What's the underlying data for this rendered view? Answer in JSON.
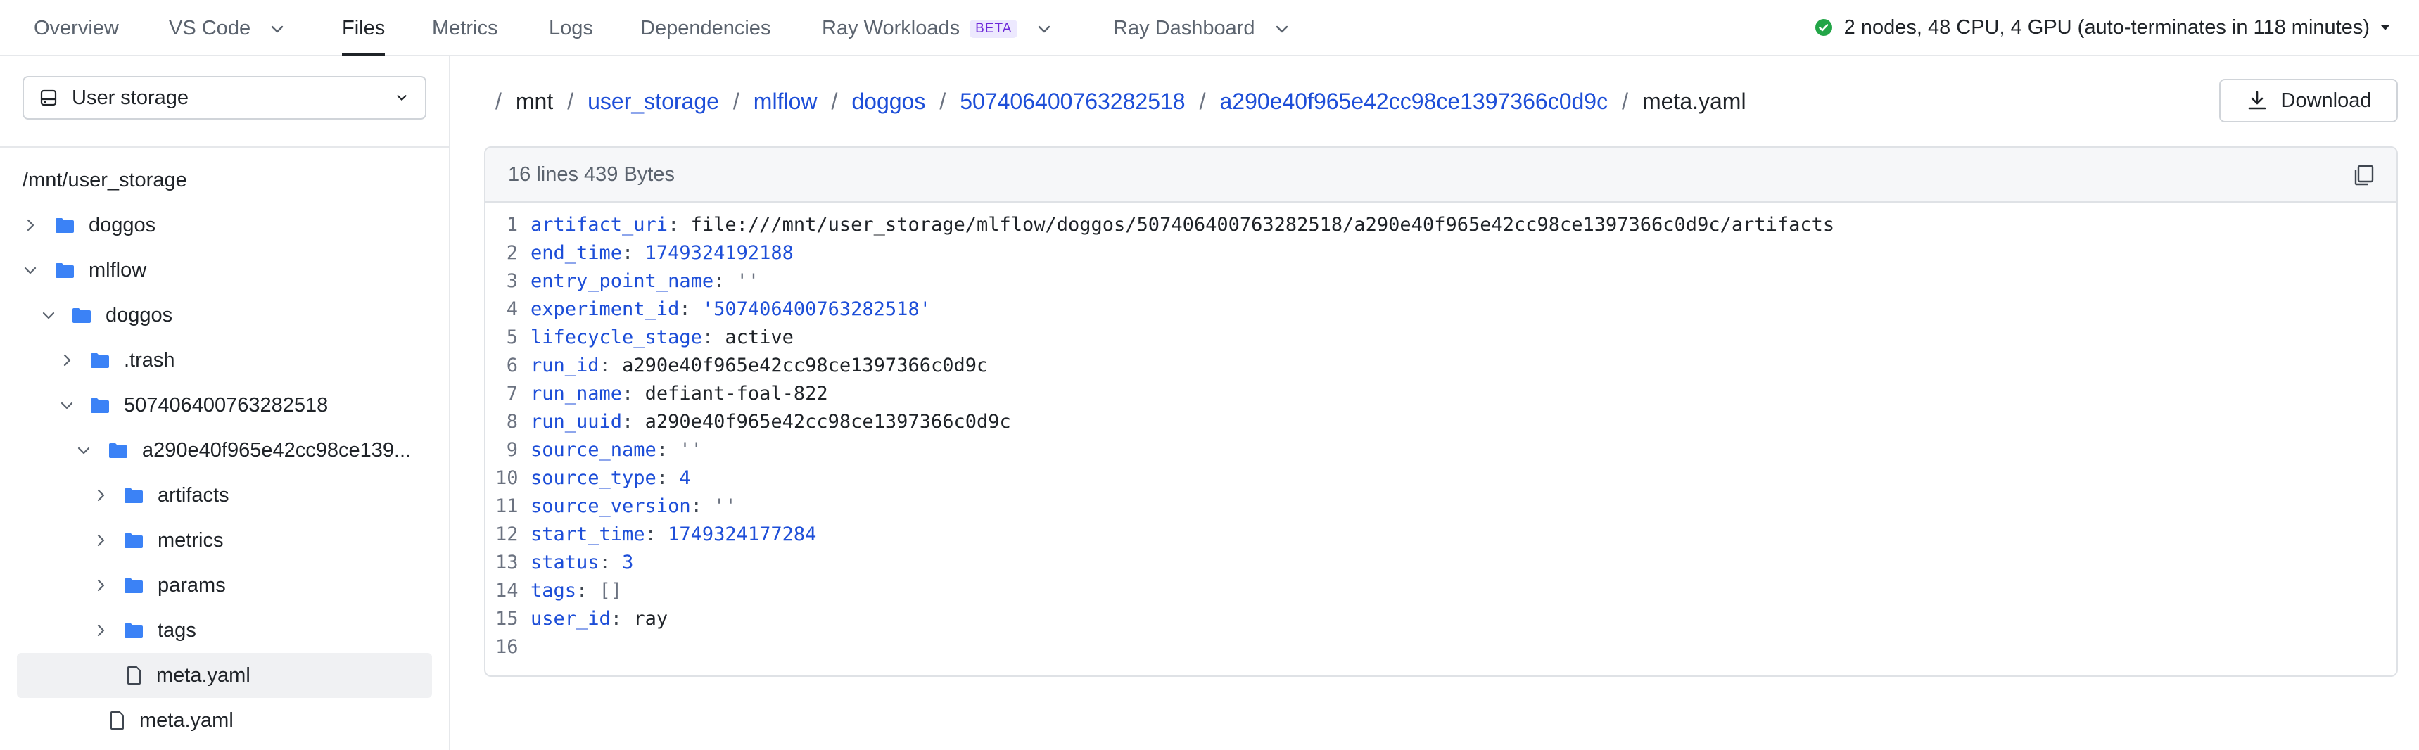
{
  "nav": {
    "items": [
      {
        "label": "Overview",
        "active": false
      },
      {
        "label": "VS Code",
        "active": false,
        "dropdown": true
      },
      {
        "label": "Files",
        "active": true
      },
      {
        "label": "Metrics",
        "active": false
      },
      {
        "label": "Logs",
        "active": false
      },
      {
        "label": "Dependencies",
        "active": false
      },
      {
        "label": "Ray Workloads",
        "active": false,
        "dropdown": true,
        "badge": "BETA"
      },
      {
        "label": "Ray Dashboard",
        "active": false,
        "dropdown": true
      }
    ],
    "cluster_status": "2 nodes, 48 CPU, 4 GPU  (auto-terminates in 118 minutes)",
    "status_color": "#22a547"
  },
  "sidebar": {
    "storage_select": "User storage",
    "root_path": "/mnt/user_storage",
    "tree": [
      {
        "label": "doggos",
        "type": "folder",
        "expanded": false
      },
      {
        "label": "mlflow",
        "type": "folder",
        "expanded": true
      },
      {
        "label": "doggos",
        "type": "folder",
        "expanded": true
      },
      {
        "label": ".trash",
        "type": "folder",
        "expanded": false
      },
      {
        "label": "507406400763282518",
        "type": "folder",
        "expanded": true
      },
      {
        "label": "a290e40f965e42cc98ce139...",
        "type": "folder",
        "expanded": true
      },
      {
        "label": "artifacts",
        "type": "folder",
        "expanded": false
      },
      {
        "label": "metrics",
        "type": "folder",
        "expanded": false
      },
      {
        "label": "params",
        "type": "folder",
        "expanded": false
      },
      {
        "label": "tags",
        "type": "folder",
        "expanded": false
      },
      {
        "label": "meta.yaml",
        "type": "file",
        "selected": true
      },
      {
        "label": "meta.yaml",
        "type": "file",
        "selected": false
      }
    ]
  },
  "breadcrumb": {
    "separator": "/",
    "parts": [
      "mnt",
      "user_storage",
      "mlflow",
      "doggos",
      "507406400763282518",
      "a290e40f965e42cc98ce1397366c0d9c",
      "meta.yaml"
    ]
  },
  "download_label": "Download",
  "file": {
    "info": "16 lines 439 Bytes",
    "lines": [
      {
        "n": "1",
        "key": "artifact_uri",
        "value": "file:///mnt/user_storage/mlflow/doggos/507406400763282518/a290e40f965e42cc98ce1397366c0d9c/artifacts"
      },
      {
        "n": "2",
        "key": "end_time",
        "value": "1749324192188"
      },
      {
        "n": "3",
        "key": "entry_point_name",
        "value": "''"
      },
      {
        "n": "4",
        "key": "experiment_id",
        "value": "'507406400763282518'"
      },
      {
        "n": "5",
        "key": "lifecycle_stage",
        "value": "active"
      },
      {
        "n": "6",
        "key": "run_id",
        "value": "a290e40f965e42cc98ce1397366c0d9c"
      },
      {
        "n": "7",
        "key": "run_name",
        "value": "defiant-foal-822"
      },
      {
        "n": "8",
        "key": "run_uuid",
        "value": "a290e40f965e42cc98ce1397366c0d9c"
      },
      {
        "n": "9",
        "key": "source_name",
        "value": "''"
      },
      {
        "n": "10",
        "key": "source_type",
        "value": "4"
      },
      {
        "n": "11",
        "key": "source_version",
        "value": "''"
      },
      {
        "n": "12",
        "key": "start_time",
        "value": "1749324177284"
      },
      {
        "n": "13",
        "key": "status",
        "value": "3"
      },
      {
        "n": "14",
        "key": "tags",
        "value": "[]"
      },
      {
        "n": "15",
        "key": "user_id",
        "value": "ray"
      },
      {
        "n": "16",
        "key": "",
        "value": ""
      }
    ]
  },
  "colors": {
    "accent": "#1d4ed8",
    "folder": "#3b82f6"
  }
}
